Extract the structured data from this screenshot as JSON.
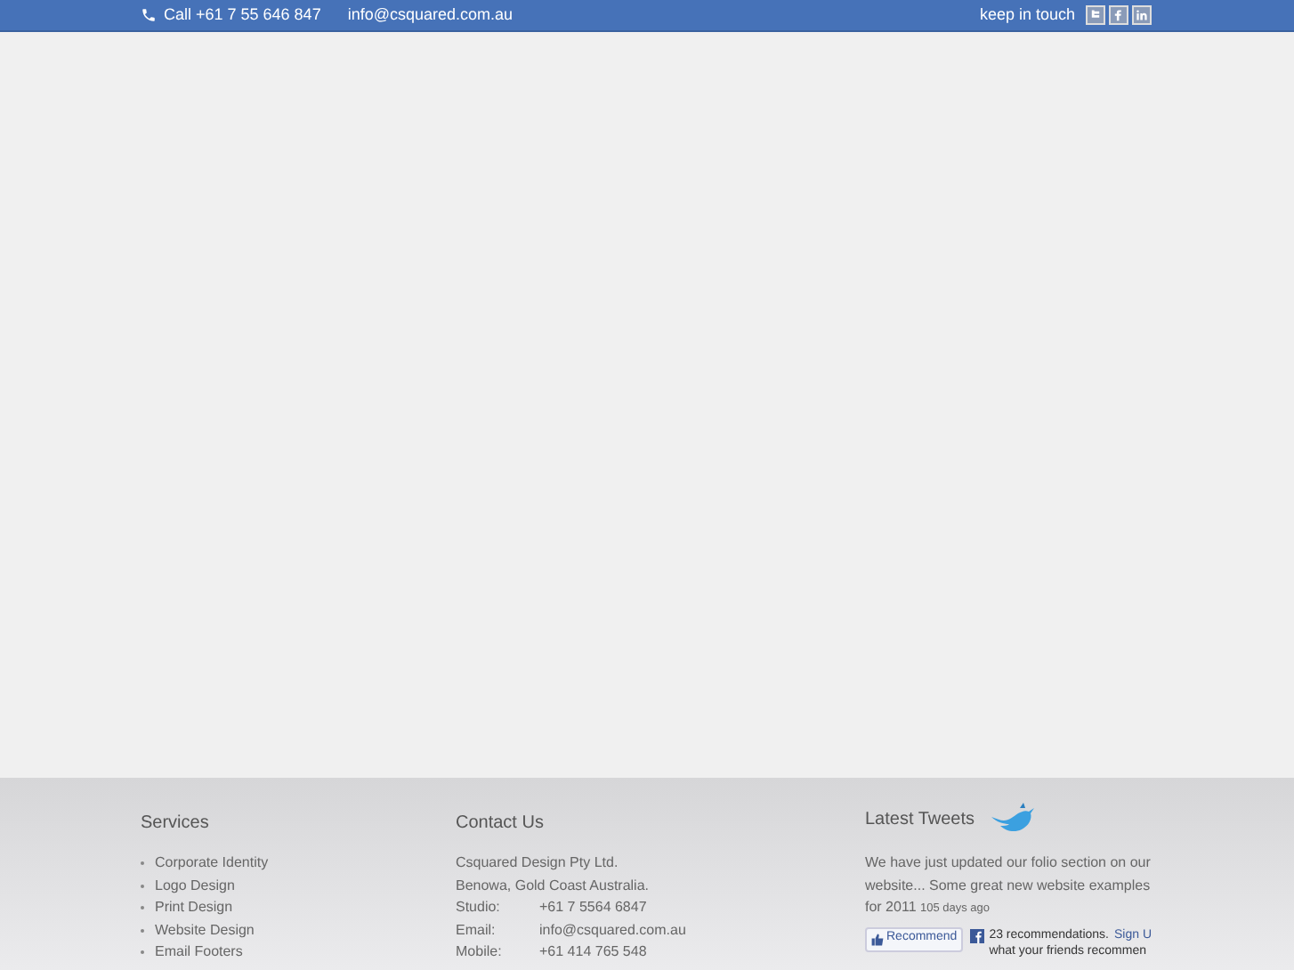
{
  "top_bar": {
    "phone": "Call +61 7 55 646 847",
    "email": "info@csquared.com.au",
    "keep_in_touch": "keep in touch"
  },
  "services": {
    "title": "Services",
    "items": [
      "Corporate Identity",
      "Logo Design",
      "Print Design",
      "Website Design",
      "Email Footers"
    ]
  },
  "contact": {
    "title": "Contact Us",
    "company": "Csquared Design Pty Ltd.",
    "address": "Benowa, Gold Coast Australia.",
    "rows": [
      {
        "label": "Studio:",
        "value": "+61 7 5564 6847"
      },
      {
        "label": "Email:",
        "value": "info@csquared.com.au"
      },
      {
        "label": "Mobile:",
        "value": "+61 414 765 548"
      }
    ]
  },
  "tweets": {
    "title": "Latest Tweets",
    "text": "We have just updated our folio section on our website... Some great new website examples for 2011",
    "time": "105 days ago",
    "recommend_button": "Recommend",
    "recommendations": "23 recommendations.",
    "sign_up": "Sign U",
    "friends": "what your friends recommen"
  }
}
